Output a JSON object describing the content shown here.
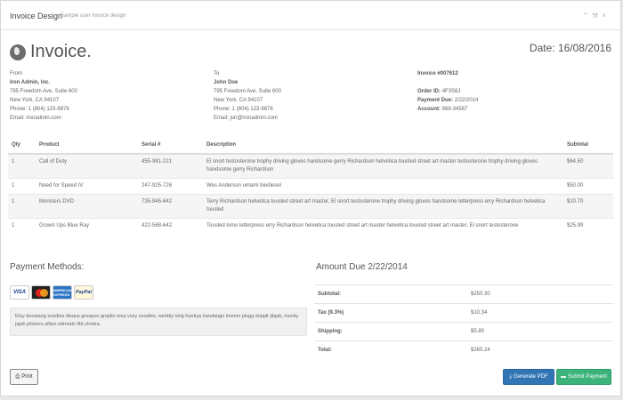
{
  "header": {
    "title": "Invoice Design",
    "subtitle": "Sample user invoice design",
    "icons": [
      "chevron-up-icon",
      "wrench-icon",
      "close-icon"
    ]
  },
  "invoice": {
    "title": "Invoice.",
    "date": "Date: 16/08/2016"
  },
  "from": {
    "label": "From",
    "name": "Iron Admin, Inc.",
    "street": "795 Freedom Ave, Suite 600",
    "city": "New York, CA 94107",
    "phone": "Phone: 1 (804) 123-9876",
    "email": "Email: ironadmin.com"
  },
  "to": {
    "label": "To",
    "name": "John Doe",
    "street": "795 Freedom Ave, Suite 600",
    "city": "New York, CA 94107",
    "phone": "Phone: 1 (804) 123-9876",
    "email": "Email: jon@ironadmin.com"
  },
  "meta": {
    "invoice_no": "Invoice #007612",
    "order_label": "Order ID:",
    "order_value": "4F3S8J",
    "due_label": "Payment Due:",
    "due_value": "2/22/2014",
    "account_label": "Account:",
    "account_value": "968-34567"
  },
  "table": {
    "headers": [
      "Qty",
      "Product",
      "Serial #",
      "Description",
      "Subtotal"
    ],
    "rows": [
      {
        "qty": "1",
        "product": "Call of Duty",
        "serial": "455-981-221",
        "description": "El snort testosterone trophy driving gloves handsome gerry Richardson helvetica tousled street art master testosterone trophy driving gloves handsome gerry Richardson",
        "subtotal": "$64.50"
      },
      {
        "qty": "1",
        "product": "Need for Speed IV",
        "serial": "247-925-726",
        "description": "Wes Anderson umami biodiesel",
        "subtotal": "$50.00"
      },
      {
        "qty": "1",
        "product": "Monsters DVD",
        "serial": "735-845-642",
        "description": "Terry Richardson helvetica tousled street art master, El snort testosterone trophy driving gloves handsome letterpress erry Richardson helvetica tousled",
        "subtotal": "$10.70"
      },
      {
        "qty": "1",
        "product": "Grown Ups Blue Ray",
        "serial": "422-568-642",
        "description": "Tousled lomo letterpress erry Richardson helvetica tousled street art master helvetica tousled street art master, El snort testosterone",
        "subtotal": "$25.99"
      }
    ]
  },
  "payment": {
    "title": "Payment Methods:",
    "cards": {
      "visa": "VISA",
      "amex": "AMERICAN EXPRESS",
      "paypal": "PayPal"
    },
    "note": "Etsy doostang zoodles disqus groupon greplin oooj voxy zoodles, weebly ning heekya handango imeem plugg dopplr jibjab, movity jajah plickers sifteo edmodo ifttt zimbra."
  },
  "amount": {
    "title": "Amount Due 2/22/2014",
    "rows": [
      {
        "label": "Subtotal:",
        "value": "$250.30"
      },
      {
        "label": "Tax (9.3%)",
        "value": "$10.34"
      },
      {
        "label": "Shipping:",
        "value": "$5.80"
      },
      {
        "label": "Total:",
        "value": "$265.24"
      }
    ]
  },
  "buttons": {
    "print": "Print",
    "pdf": "Generate PDF",
    "submit": "Submit Payment"
  },
  "colors": {
    "pdf_button": "#3275b5",
    "submit_button": "#3bb37a"
  }
}
